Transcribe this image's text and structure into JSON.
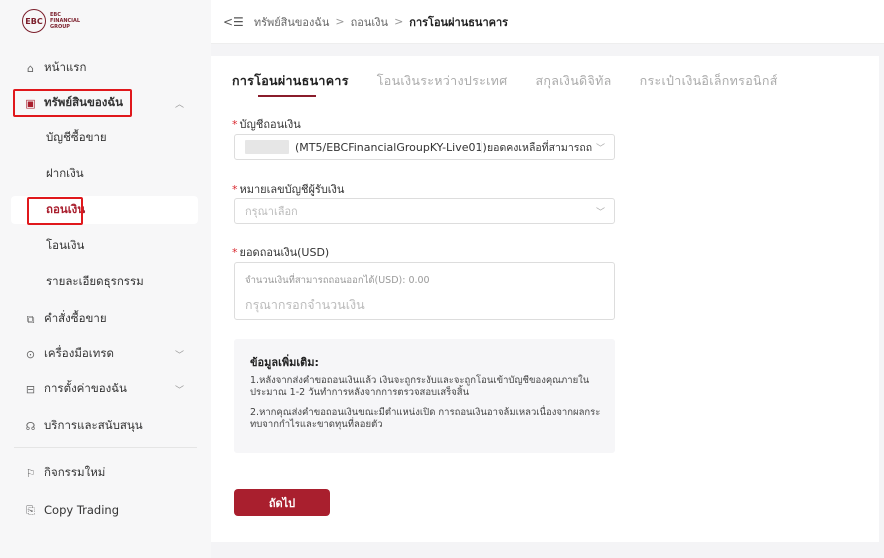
{
  "logo": {
    "mark": "EBC",
    "text_line1": "EBC",
    "text_line2": "FINANCIAL",
    "text_line3": "GROUP"
  },
  "sidebar": {
    "items": [
      {
        "label": "หน้าแรก",
        "icon": "home-icon"
      },
      {
        "label": "ทรัพย์สินของฉัน",
        "icon": "wallet-icon",
        "expanded": true
      },
      {
        "label": "คำสั่งซื้อขาย",
        "icon": "orders-icon"
      },
      {
        "label": "เครื่องมือเทรด",
        "icon": "tools-icon"
      },
      {
        "label": "การตั้งค่าของฉัน",
        "icon": "settings-icon"
      },
      {
        "label": "บริการและสนับสนุน",
        "icon": "support-icon"
      },
      {
        "label": "กิจกรรมใหม่",
        "icon": "flag-icon"
      },
      {
        "label": "Copy Trading",
        "icon": "copy-icon"
      }
    ],
    "subitems": [
      {
        "label": "บัญชีซื้อขาย"
      },
      {
        "label": "ฝากเงิน"
      },
      {
        "label": "ถอนเงิน",
        "active": true
      },
      {
        "label": "โอนเงิน"
      },
      {
        "label": "รายละเอียดธุรกรรม"
      }
    ]
  },
  "breadcrumb": {
    "toggle": "<☰",
    "items": [
      "ทรัพย์สินของฉัน",
      "ถอนเงิน",
      "การโอนผ่านธนาคาร"
    ],
    "separator": ">"
  },
  "tabs": [
    {
      "label": "การโอนผ่านธนาคาร",
      "active": true
    },
    {
      "label": "โอนเงินระหว่างประเทศ"
    },
    {
      "label": "สกุลเงินดิจิทัล"
    },
    {
      "label": "กระเป๋าเงินอิเล็กทรอนิกส์"
    }
  ],
  "form": {
    "account": {
      "label": "บัญชีถอนเงิน",
      "value": "(MT5/EBCFinancialGroupKY-Live01)",
      "balance": "ยอดคงเหลือที่สามารถถ"
    },
    "receiver": {
      "label": "หมายเลขบัญชีผู้รับเงิน",
      "placeholder": "กรุณาเลือก"
    },
    "amount": {
      "label": "ยอดถอนเงิน(USD)",
      "hint": "จำนวนเงินที่สามารถถอนออกได้(USD): 0.00",
      "placeholder": "กรุณากรอกจำนวนเงิน"
    }
  },
  "info": {
    "title": "ข้อมูลเพิ่มเติม:",
    "p1": "1.หลังจากส่งคำขอถอนเงินแล้ว เงินจะถูกระงับและจะถูกโอนเข้าบัญชีของคุณภายในประมาณ 1-2 วันทำการหลังจากการตรวจสอบเสร็จสิ้น",
    "p2": "2.หากคุณส่งคำขอถอนเงินขณะมีตำแหน่งเปิด การถอนเงินอาจล้มเหลวเนื่องจากผลกระทบจากกำไรและขาดทุนที่ลอยตัว"
  },
  "next_button": "ถัดไป",
  "colors": {
    "accent": "#a91f2e",
    "highlight": "#e0181c"
  }
}
